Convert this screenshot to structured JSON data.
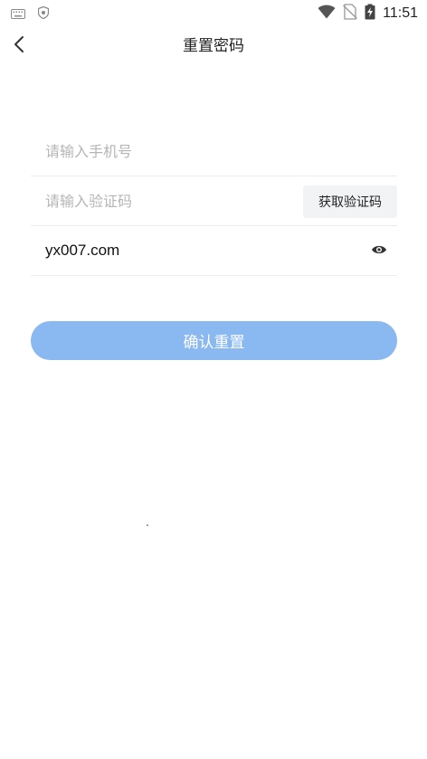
{
  "status_bar": {
    "time": "11:51",
    "icons": [
      "keyboard-icon",
      "shield-icon",
      "wifi-icon",
      "no-sim-icon",
      "battery-charging-icon"
    ]
  },
  "header": {
    "title": "重置密码",
    "back_icon": "chevron-left-icon"
  },
  "form": {
    "phone": {
      "placeholder": "请输入手机号",
      "value": ""
    },
    "code": {
      "placeholder": "请输入验证码",
      "value": "",
      "button_label": "获取验证码"
    },
    "password": {
      "value": "yx007.com",
      "toggle_icon": "eye-icon"
    }
  },
  "submit": {
    "label": "确认重置",
    "color": "#8ab8f0"
  }
}
